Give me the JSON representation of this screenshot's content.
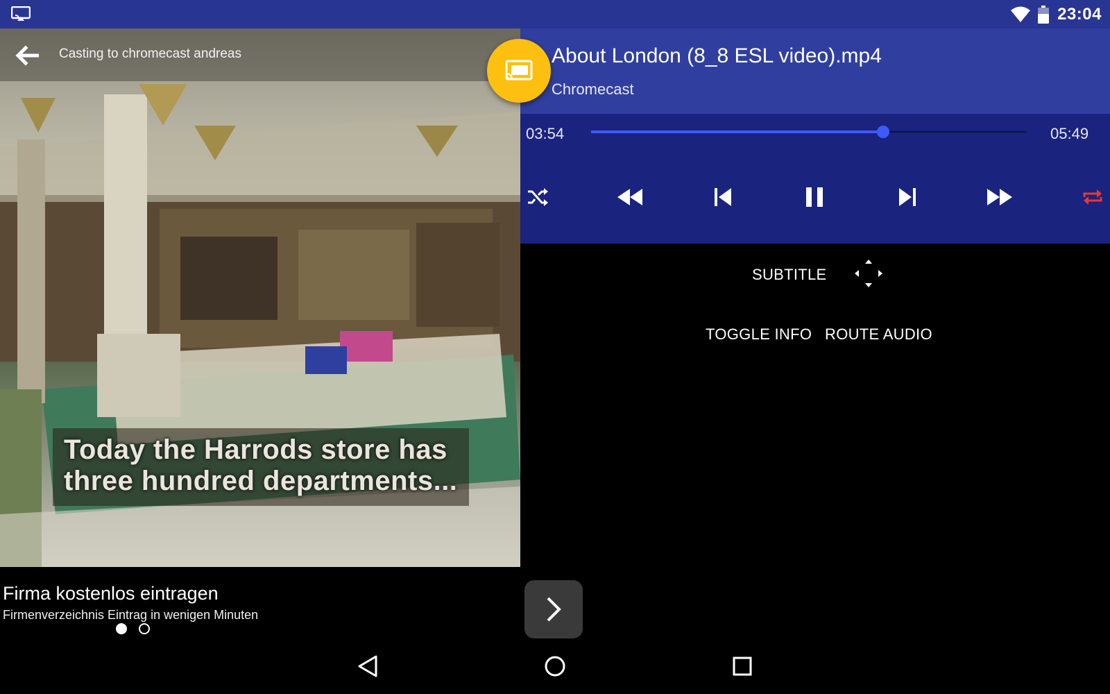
{
  "status_bar": {
    "time": "23:04",
    "icons": [
      "cast-notification-icon",
      "wifi-icon",
      "battery-icon"
    ]
  },
  "video": {
    "casting_text": "Casting to chromecast andreas",
    "subtitle_lines": [
      "Today the Harrods store has",
      "three hundred departments..."
    ]
  },
  "media": {
    "title": "About London (8_8 ESL video).mp4",
    "device": "Chromecast",
    "elapsed": "03:54",
    "duration": "05:49",
    "progress": 0.67,
    "controls": [
      "shuffle-icon",
      "rewind-icon",
      "skip-previous-icon",
      "pause-icon",
      "skip-next-icon",
      "fast-forward-icon",
      "repeat-icon"
    ],
    "repeat_active_color": "#e53935"
  },
  "options": {
    "subtitle_label": "SUBTITLE",
    "toggle_info_label": "TOGGLE INFO",
    "route_audio_label": "ROUTE AUDIO"
  },
  "ad": {
    "title": "Firma kostenlos eintragen",
    "subtitle": "Firmenverzeichnis Eintrag in wenigen Minuten",
    "page_count": 2,
    "active_page": 1
  },
  "colors": {
    "status_bar": "#283593",
    "header": "#303f9f",
    "controls": "#1a237e",
    "accent": "#3d5afe",
    "fab": "#fdc010"
  }
}
